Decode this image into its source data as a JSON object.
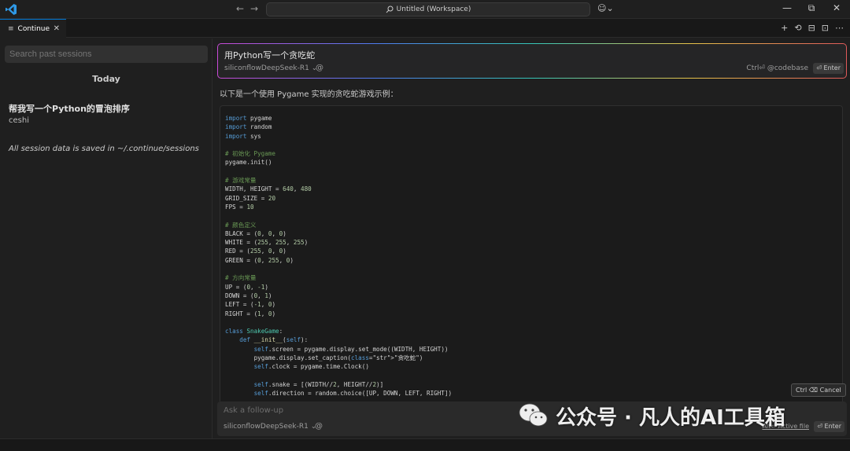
{
  "titlebar": {
    "back_icon": "arrow-left-icon",
    "forward_icon": "arrow-right-icon",
    "command_center": "Untitled (Workspace)",
    "accounts_icon": "copilot-icon",
    "minimize": "—",
    "restore": "⧉",
    "close": "✕"
  },
  "tab": {
    "label": "Continue",
    "close": "✕"
  },
  "tab_actions": [
    "+",
    "⟲",
    "⊟",
    "⊡",
    "⋯"
  ],
  "sidebar": {
    "search_placeholder": "Search past sessions",
    "group_heading": "Today",
    "sessions": [
      {
        "title": "帮我写一个Python的冒泡排序",
        "subtitle": "ceshi"
      }
    ],
    "note": "All session data is saved in ~/.continue/sessions"
  },
  "main": {
    "input": {
      "text": "用Python写一个贪吃蛇",
      "model": "siliconflowDeepSeek-R1",
      "at": "@",
      "hint": "Ctrl⏎ @codebase",
      "enter": "⏎ Enter"
    },
    "response_intro": "以下是一个使用 Pygame 实现的贪吃蛇游戏示例：",
    "cancel": "Ctrl ⌫ Cancel",
    "followup": {
      "placeholder": "Ask a follow-up",
      "model": "siliconflowDeepSeek-R1",
      "at": "@",
      "active_file": "Alt⏎ Active file",
      "enter": "⏎ Enter"
    }
  },
  "code_lines": [
    "import pygame",
    "import random",
    "import sys",
    "",
    "# 初始化 Pygame",
    "pygame.init()",
    "",
    "# 游戏常量",
    "WIDTH, HEIGHT = 640, 480",
    "GRID_SIZE = 20",
    "FPS = 10",
    "",
    "# 颜色定义",
    "BLACK = (0, 0, 0)",
    "WHITE = (255, 255, 255)",
    "RED = (255, 0, 0)",
    "GREEN = (0, 255, 0)",
    "",
    "# 方向常量",
    "UP = (0, -1)",
    "DOWN = (0, 1)",
    "LEFT = (-1, 0)",
    "RIGHT = (1, 0)",
    "",
    "class SnakeGame:",
    "    def __init__(self):",
    "        self.screen = pygame.display.set_mode((WIDTH, HEIGHT))",
    "        pygame.display.set_caption(\"贪吃蛇\")",
    "        self.clock = pygame.time.Clock()",
    "",
    "        self.snake = [(WIDTH//2, HEIGHT//2)]",
    "        self.direction = random.choice([UP, DOWN, LEFT, RIGHT])"
  ],
  "watermark": {
    "logo": "wechat-icon",
    "text": "公众号 · 凡人的AI工具箱"
  },
  "colors": {
    "accent": "#0078d4",
    "background": "#1f1f1f",
    "keyword": "#569cd6",
    "comment": "#6a9955",
    "string": "#ce9178",
    "number": "#b5cea8"
  }
}
